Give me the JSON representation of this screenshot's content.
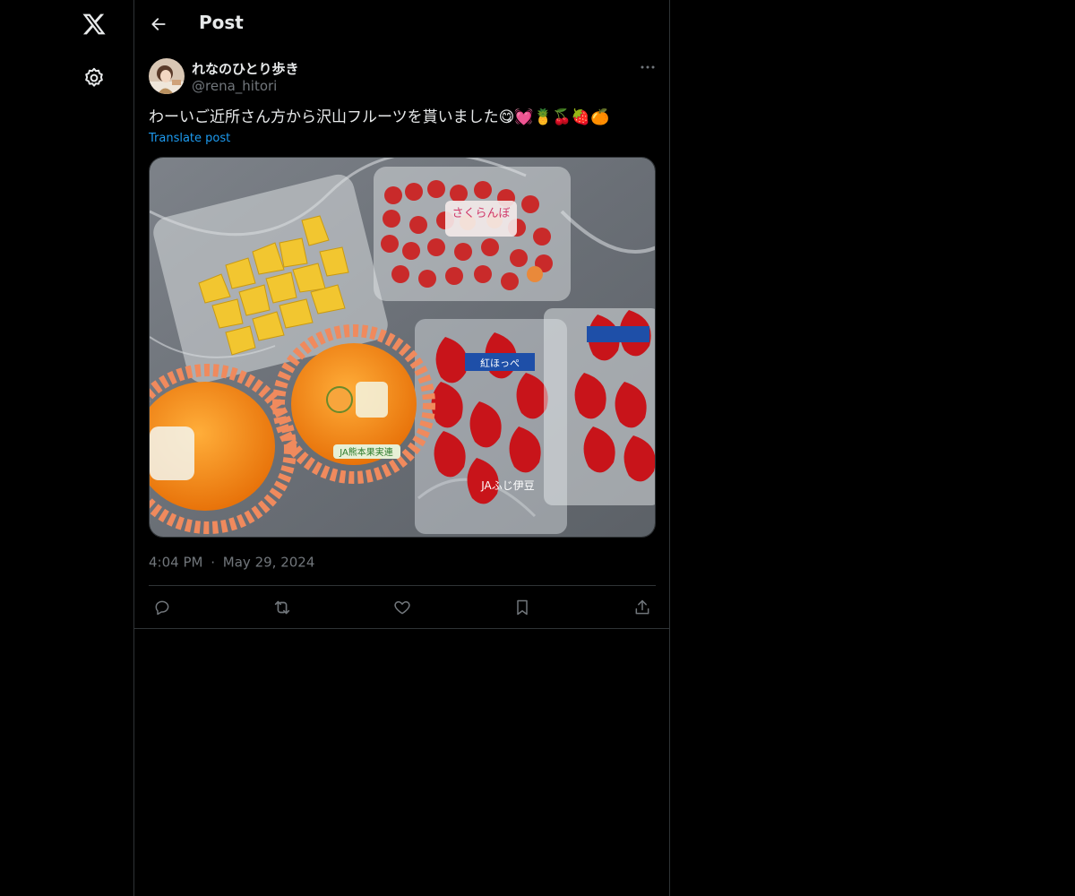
{
  "header": {
    "title": "Post"
  },
  "post": {
    "display_name": "れなのひとり歩き",
    "handle": "@rena_hitori",
    "text": "わーいご近所さん方から沢山フルーツを貰いました😋💓🍍🍒🍓🍊",
    "translate_label": "Translate post",
    "time": "4:04 PM",
    "separator": "·",
    "date": "May 29, 2024"
  },
  "media": {
    "label_cherries": "さくらんぼ",
    "label_strawberry_brand": "紅ほっぺ",
    "label_ja": "JAふじ伊豆",
    "label_orange": "JA熊本果実連"
  },
  "icons": {
    "logo": "x-logo-icon",
    "settings": "gear-icon",
    "back": "arrow-left-icon",
    "more": "more-dots-icon",
    "reply": "reply-icon",
    "repost": "repost-icon",
    "like": "heart-icon",
    "bookmark": "bookmark-icon",
    "share": "share-icon"
  },
  "colors": {
    "background": "#000000",
    "text": "#e7e9ea",
    "muted": "#71767b",
    "border": "#2f3336",
    "link": "#1d9bf0"
  }
}
